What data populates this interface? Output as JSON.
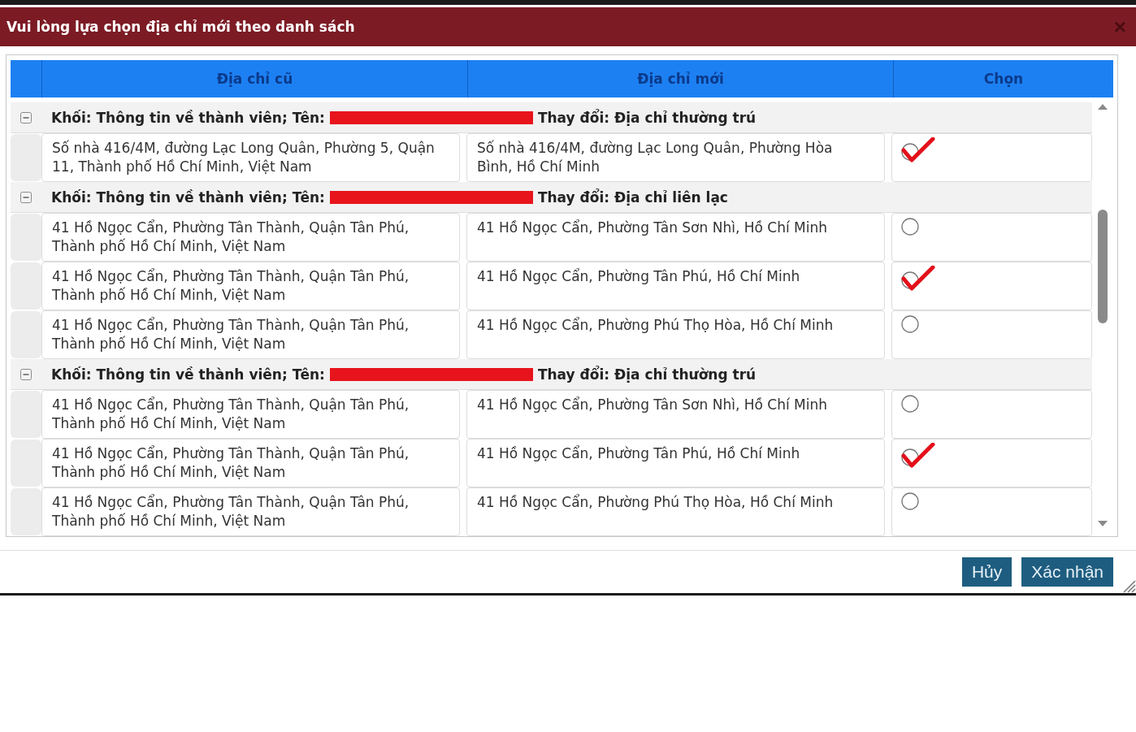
{
  "dialog": {
    "title": "Vui lòng lựa chọn địa chỉ mới theo danh sách",
    "close": "×"
  },
  "columns": [
    "Địa chỉ cũ",
    "Địa chỉ mới",
    "Chọn"
  ],
  "groups": [
    {
      "expanded": true,
      "prefix": "Khối: Thông tin về thành viên; Tên:",
      "suffix": "Thay đổi: Địa chỉ thường trú",
      "rows": [
        {
          "old": "Số nhà 416/4M, đường Lạc Long Quân, Phường 5, Quận 11, Thành phố Hồ Chí Minh, Việt Nam",
          "new": "Số nhà 416/4M, đường Lạc Long Quân, Phường Hòa Bình, Hồ Chí Minh",
          "selected": true
        }
      ]
    },
    {
      "expanded": true,
      "prefix": "Khối: Thông tin về thành viên; Tên:",
      "suffix": "Thay đổi: Địa chỉ liên lạc",
      "rows": [
        {
          "old": "41 Hồ Ngọc Cẩn, Phường Tân Thành, Quận Tân Phú, Thành phố Hồ Chí Minh, Việt Nam",
          "new": "41 Hồ Ngọc Cẩn, Phường Tân Sơn Nhì, Hồ Chí Minh",
          "selected": false
        },
        {
          "old": "41 Hồ Ngọc Cẩn, Phường Tân Thành, Quận Tân Phú, Thành phố Hồ Chí Minh, Việt Nam",
          "new": "41 Hồ Ngọc Cẩn, Phường Tân Phú, Hồ Chí Minh",
          "selected": true
        },
        {
          "old": "41 Hồ Ngọc Cẩn, Phường Tân Thành, Quận Tân Phú, Thành phố Hồ Chí Minh, Việt Nam",
          "new": "41 Hồ Ngọc Cẩn, Phường Phú Thọ Hòa, Hồ Chí Minh",
          "selected": false
        }
      ]
    },
    {
      "expanded": true,
      "prefix": "Khối: Thông tin về thành viên; Tên:",
      "suffix": "Thay đổi: Địa chỉ thường trú",
      "rows": [
        {
          "old": "41 Hồ Ngọc Cẩn, Phường Tân Thành, Quận Tân Phú, Thành phố Hồ Chí Minh, Việt Nam",
          "new": "41 Hồ Ngọc Cẩn, Phường Tân Sơn Nhì, Hồ Chí Minh",
          "selected": false
        },
        {
          "old": "41 Hồ Ngọc Cẩn, Phường Tân Thành, Quận Tân Phú, Thành phố Hồ Chí Minh, Việt Nam",
          "new": "41 Hồ Ngọc Cẩn, Phường Tân Phú, Hồ Chí Minh",
          "selected": true
        },
        {
          "old": "41 Hồ Ngọc Cẩn, Phường Tân Thành, Quận Tân Phú, Thành phố Hồ Chí Minh, Việt Nam",
          "new": "41 Hồ Ngọc Cẩn, Phường Phú Thọ Hòa, Hồ Chí Minh",
          "selected": false
        }
      ]
    }
  ],
  "buttons": [
    "Hủy",
    "Xác nhận"
  ]
}
